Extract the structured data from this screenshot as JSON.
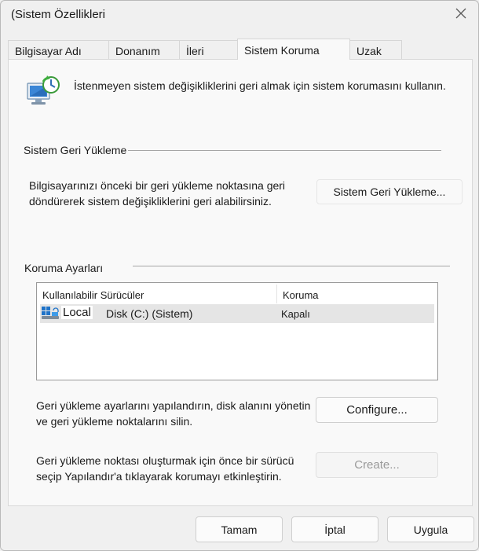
{
  "window": {
    "title": "(Sistem Özellikleri"
  },
  "tabs": [
    {
      "label": "Bilgisayar Adı"
    },
    {
      "label": "Donanım"
    },
    {
      "label": "İleri"
    },
    {
      "label": "Sistem Koruma"
    },
    {
      "label": "Uzak"
    }
  ],
  "active_tab": "Sistem Koruma",
  "intro": {
    "text": "İstenmeyen sistem değişikliklerini geri almak için sistem korumasını kullanın."
  },
  "restore_group": {
    "title": "Sistem Geri Yükleme",
    "desc_line1": "Bilgisayarınızı önceki bir geri yükleme noktasına geri",
    "desc_line2": "döndürerek sistem değişikliklerini geri alabilirsiniz.",
    "button": "Sistem Geri Yükleme..."
  },
  "protection_group": {
    "title": "Koruma Ayarları",
    "columns": [
      "Kullanılabilir Sürücüler",
      "Koruma"
    ],
    "rows": [
      {
        "drive_prefix": "Local",
        "drive": "Disk (C:) (Sistem)",
        "protection": "Kapalı",
        "icon": "drive-icon"
      }
    ],
    "configure_text_line1": "Geri yükleme ayarlarını yapılandırın, disk alanını yönetin",
    "configure_text_line2": "ve geri yükleme noktalarını silin.",
    "configure_button": "Configure...",
    "create_text_line1": "Geri yükleme noktası oluşturmak için önce bir sürücü",
    "create_text_line2": "seçip Yapılandır'a tıklayarak korumayı etkinleştirin.",
    "create_button": "Create..."
  },
  "footer": {
    "ok": "Tamam",
    "cancel": "İptal",
    "apply": "Uygula"
  },
  "colors": {
    "background": "#f0f0f0",
    "panel": "#f9f9f9",
    "selected_row": "#e5e5e5",
    "disabled_text": "#9a9a9a"
  }
}
